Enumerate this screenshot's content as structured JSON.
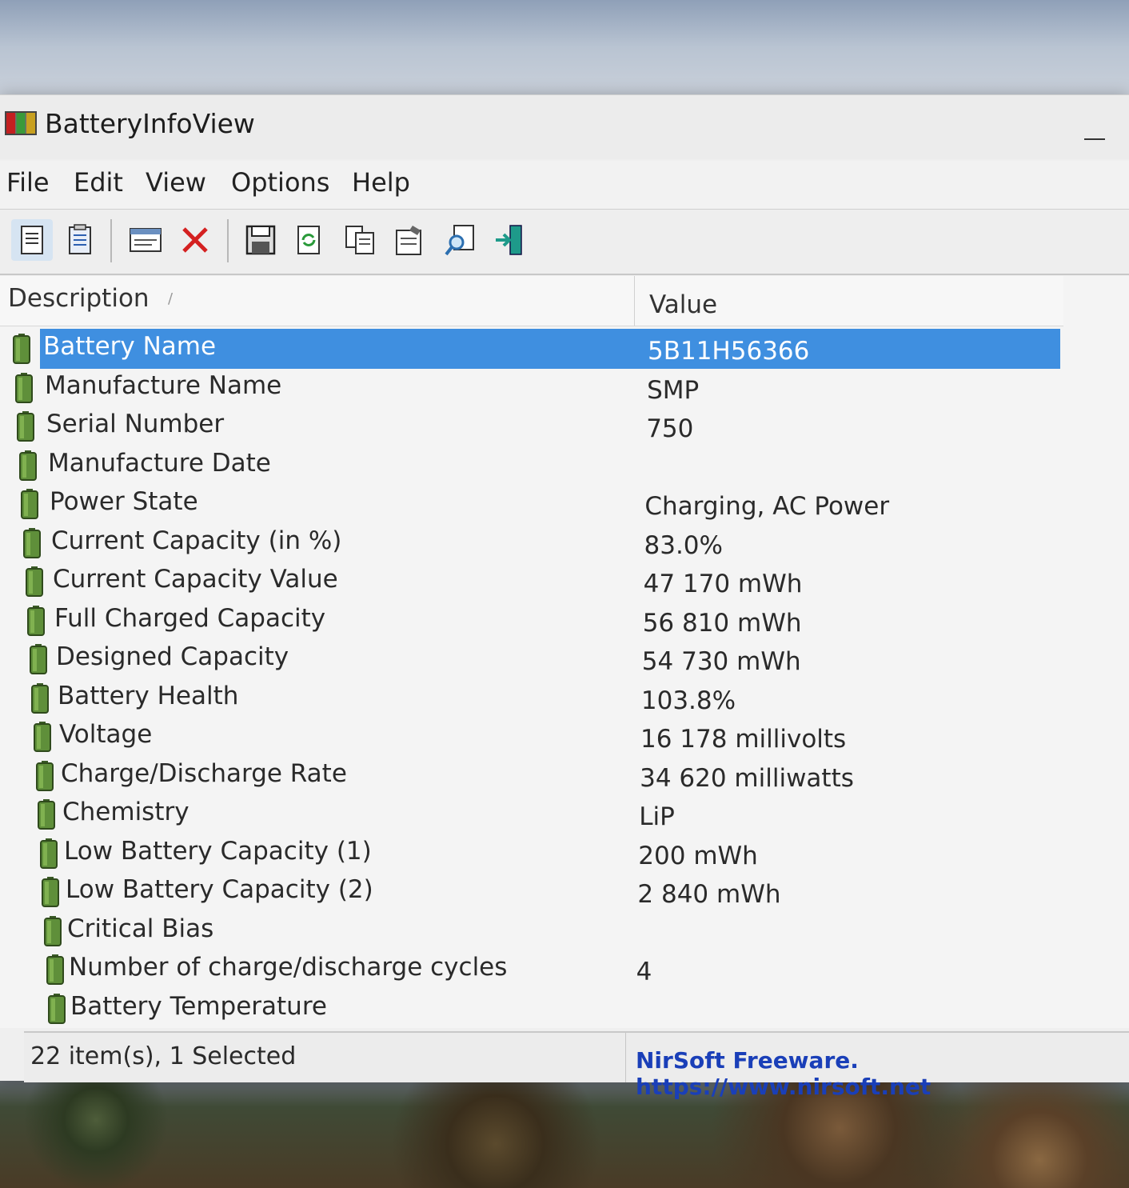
{
  "window": {
    "title": "BatteryInfoView"
  },
  "menu": [
    "File",
    "Edit",
    "View",
    "Options",
    "Help"
  ],
  "toolbar": {
    "buttons": [
      "html-report-all-icon",
      "html-report-selected-icon",
      "properties-icon",
      "delete-icon",
      "save-icon",
      "refresh-icon",
      "copy-icon",
      "options-icon",
      "find-icon",
      "exit-icon"
    ]
  },
  "columns": {
    "description": "Description",
    "value": "Value"
  },
  "rows": [
    {
      "description": "Battery Name",
      "value": "5B11H56366",
      "selected": true
    },
    {
      "description": "Manufacture Name",
      "value": "SMP"
    },
    {
      "description": "Serial Number",
      "value": "750"
    },
    {
      "description": "Manufacture Date",
      "value": ""
    },
    {
      "description": "Power State",
      "value": "Charging, AC Power"
    },
    {
      "description": "Current Capacity (in %)",
      "value": "83.0%"
    },
    {
      "description": "Current Capacity Value",
      "value": "47 170 mWh"
    },
    {
      "description": "Full Charged Capacity",
      "value": "56 810 mWh"
    },
    {
      "description": "Designed Capacity",
      "value": "54 730 mWh"
    },
    {
      "description": "Battery Health",
      "value": "103.8%"
    },
    {
      "description": "Voltage",
      "value": "16 178 millivolts"
    },
    {
      "description": "Charge/Discharge Rate",
      "value": "34 620 milliwatts"
    },
    {
      "description": "Chemistry",
      "value": "LiP"
    },
    {
      "description": "Low Battery Capacity (1)",
      "value": "200 mWh"
    },
    {
      "description": "Low Battery Capacity (2)",
      "value": "2 840 mWh"
    },
    {
      "description": "Critical Bias",
      "value": ""
    },
    {
      "description": "Number of charge/discharge cycles",
      "value": "4"
    },
    {
      "description": "Battery Temperature",
      "value": ""
    }
  ],
  "status": {
    "items": "22 item(s), 1 Selected",
    "credit": "NirSoft Freeware. https://www.nirsoft.net"
  },
  "colors": {
    "selection": "#3f8fe0",
    "battery_icon": "#5f8f3a",
    "credit_link": "#1a3fb8"
  }
}
